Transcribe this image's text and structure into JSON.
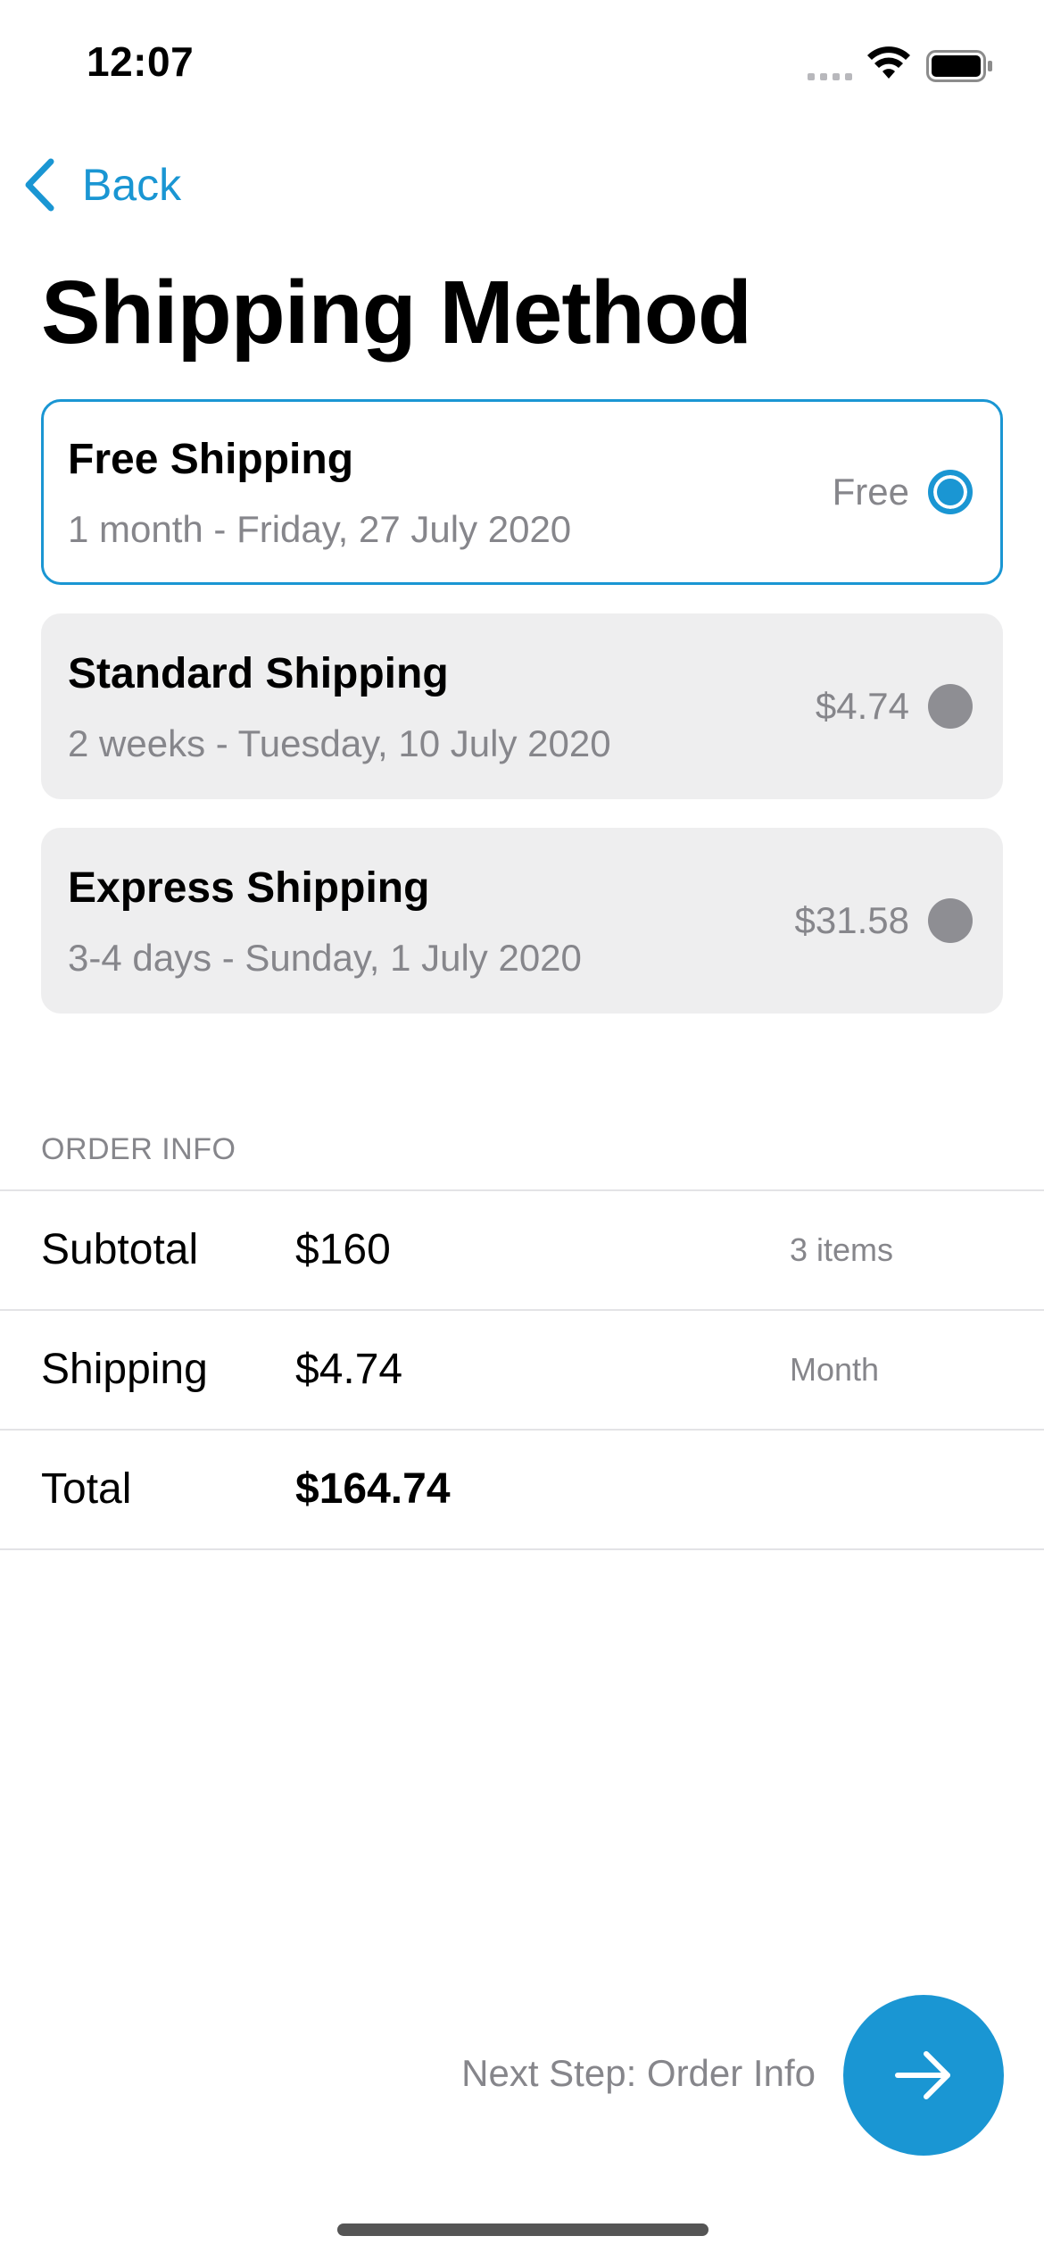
{
  "status_bar": {
    "time": "12:07",
    "icons": [
      "cellular-signal-icon",
      "wifi-icon",
      "battery-icon"
    ]
  },
  "nav": {
    "back_label": "Back",
    "back_icon": "chevron-left-icon"
  },
  "page": {
    "title": "Shipping Method"
  },
  "shipping_options": [
    {
      "name": "Free Shipping",
      "detail": "1 month - Friday, 27 July 2020",
      "price": "Free",
      "selected": true
    },
    {
      "name": "Standard Shipping",
      "detail": "2 weeks - Tuesday, 10 July 2020",
      "price": "$4.74",
      "selected": false
    },
    {
      "name": "Express Shipping",
      "detail": "3-4 days - Sunday, 1 July 2020",
      "price": "$31.58",
      "selected": false
    }
  ],
  "order_info": {
    "header": "ORDER INFO",
    "rows": [
      {
        "label": "Subtotal",
        "value": "$160",
        "note": "3 items"
      },
      {
        "label": "Shipping",
        "value": "$4.74",
        "note": "Month"
      },
      {
        "label": "Total",
        "value": "$164.74",
        "note": ""
      }
    ]
  },
  "footer": {
    "next_label": "Next Step: Order Info",
    "next_icon": "arrow-right-icon"
  },
  "colors": {
    "accent": "#1a96d3",
    "card_background": "#eeeeef",
    "secondary_text": "#86868b",
    "radio_unselected": "#8e8e93"
  }
}
